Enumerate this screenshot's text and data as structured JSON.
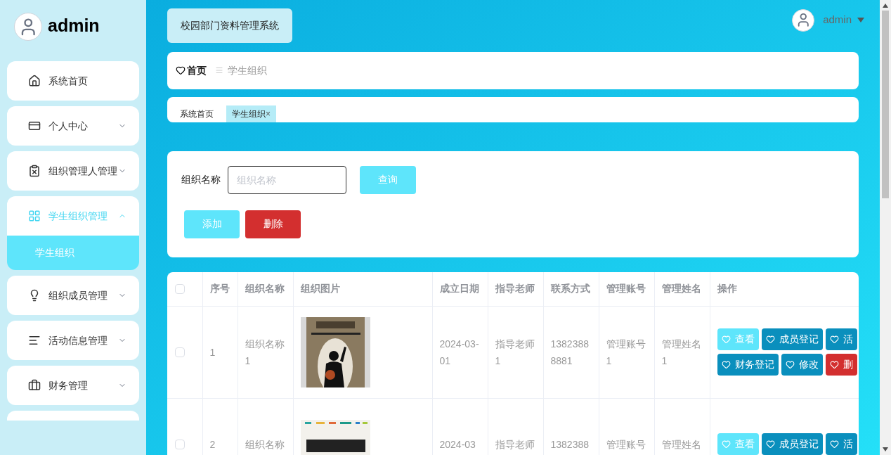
{
  "sidebar": {
    "user": "admin",
    "items": [
      {
        "label": "系统首页",
        "expandable": false,
        "expanded": false,
        "selected": false
      },
      {
        "label": "个人中心",
        "expandable": true,
        "expanded": false,
        "selected": false
      },
      {
        "label": "组织管理人管理",
        "expandable": true,
        "expanded": false,
        "selected": false
      },
      {
        "label": "学生组织管理",
        "expandable": true,
        "expanded": true,
        "selected": true,
        "children": [
          {
            "label": "学生组织",
            "selected": true
          }
        ]
      },
      {
        "label": "组织成员管理",
        "expandable": true,
        "expanded": false,
        "selected": false
      },
      {
        "label": "活动信息管理",
        "expandable": true,
        "expanded": false,
        "selected": false
      },
      {
        "label": "财务管理",
        "expandable": true,
        "expanded": false,
        "selected": false
      }
    ]
  },
  "header": {
    "title": "校园部门资料管理系统",
    "user": "admin"
  },
  "breadcrumb": [
    {
      "label": "首页",
      "current": false
    },
    {
      "label": "学生组织",
      "current": true
    }
  ],
  "tabs": [
    {
      "label": "系统首页",
      "selected": false
    },
    {
      "label": "学生组织",
      "selected": true,
      "close": "×"
    }
  ],
  "search": {
    "label": "组织名称",
    "placeholder": "组织名称",
    "button": "查询"
  },
  "actions": [
    {
      "label": "添加",
      "kind": "primary"
    },
    {
      "label": "删除",
      "kind": "danger"
    }
  ],
  "table": {
    "all_checked": false,
    "columns": [
      "序号",
      "组织名称",
      "组织图片",
      "成立日期",
      "指导老师",
      "联系方式",
      "管理账号",
      "管理姓名",
      "操作"
    ],
    "rows": [
      {
        "checked": false,
        "cells": [
          "1",
          "组织名称1",
          "",
          "2024-03-01",
          "指导老师1",
          "13823888881",
          "管理账号1",
          "管理姓名1"
        ],
        "picture": {
          "kind": "picture"
        },
        "buttons": [
          {
            "label": "查看",
            "kind": "light"
          },
          {
            "label": "成员登记",
            "kind": "primary"
          },
          {
            "label": "活",
            "kind": "primary"
          },
          {
            "label": "财务登记",
            "kind": "primary"
          },
          {
            "label": "修改",
            "kind": "primary"
          },
          {
            "label": "删",
            "kind": "danger"
          }
        ]
      },
      {
        "checked": false,
        "cells": [
          "2",
          "组织名称",
          "",
          "2024-03",
          "指导老师",
          "1382388",
          "管理账号",
          "管理姓名"
        ],
        "picture": {
          "kind": "picture"
        },
        "buttons": [
          {
            "label": "查看",
            "kind": "light"
          },
          {
            "label": "成员登记",
            "kind": "primary"
          },
          {
            "label": "活",
            "kind": "primary"
          }
        ]
      }
    ]
  }
}
